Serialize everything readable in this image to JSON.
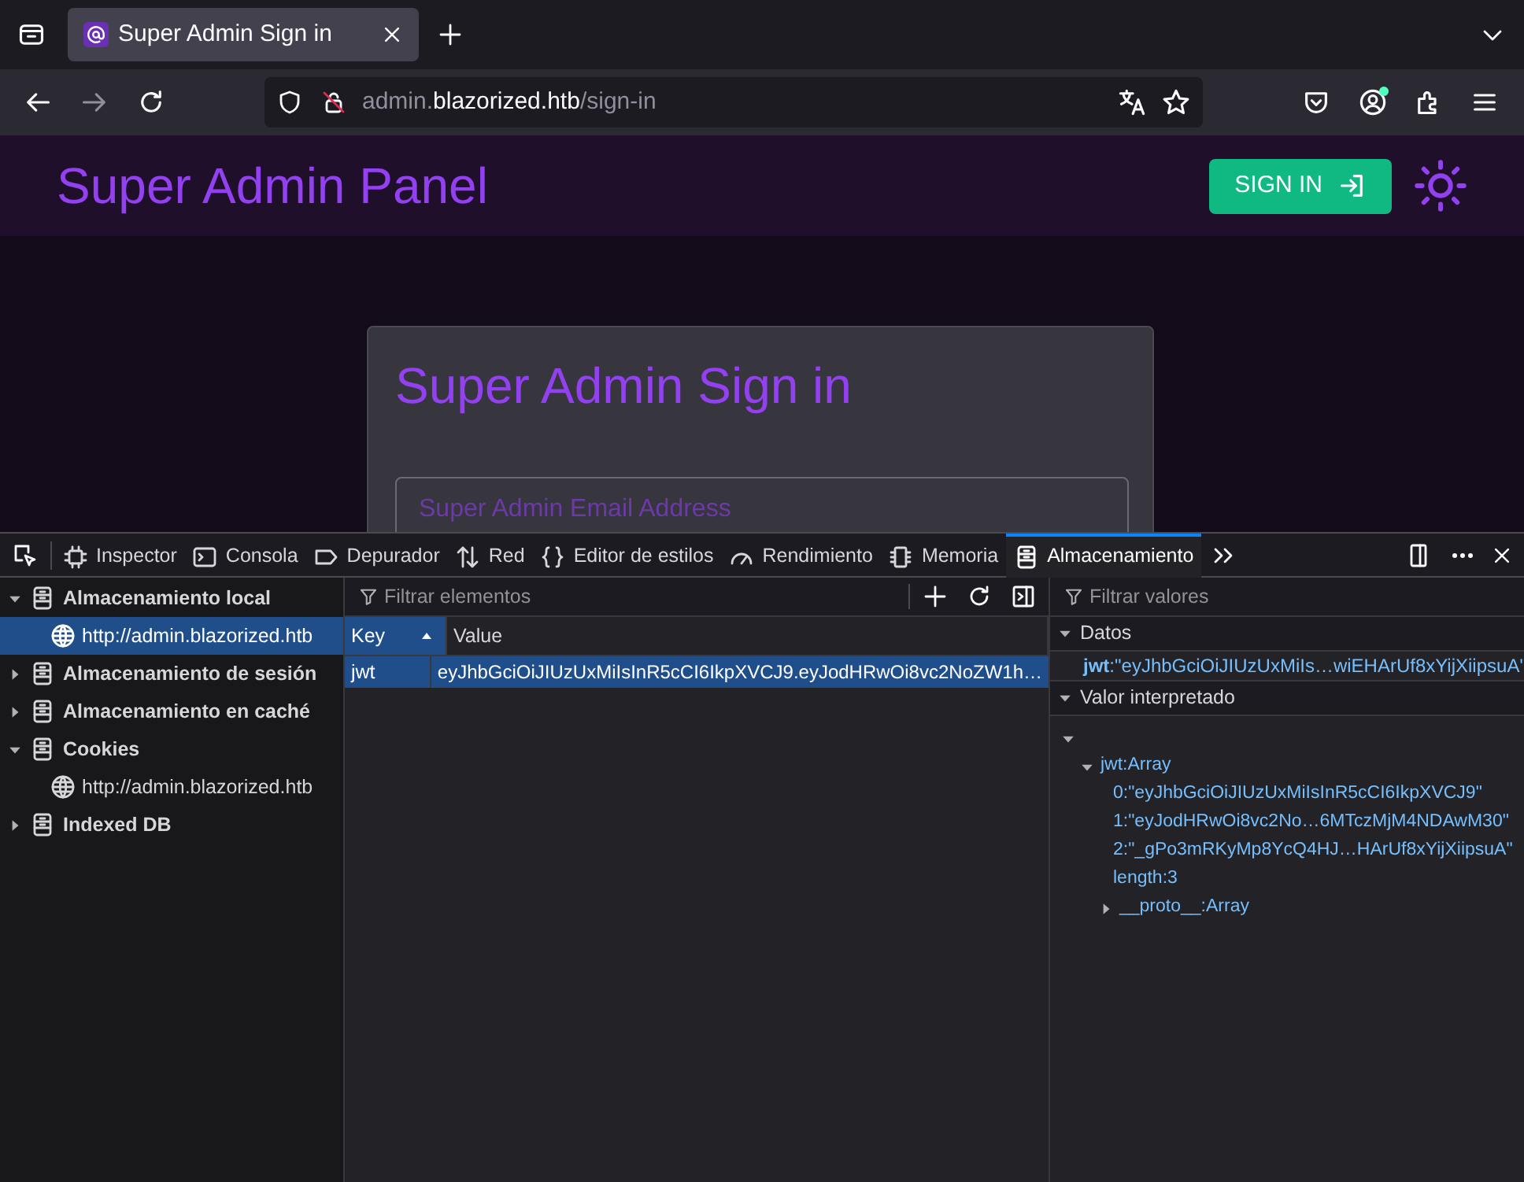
{
  "browser": {
    "tabs": [
      {
        "title": "Super Admin Sign in",
        "selected": true
      }
    ],
    "url": {
      "subdomain": "admin.",
      "domain": "blazorized.htb",
      "path": "/sign-in"
    }
  },
  "page": {
    "title": "Super Admin Panel",
    "sign_in_button": "SIGN IN",
    "card_title": "Super Admin Sign in",
    "email_field": {
      "placeholder": "Super Admin Email Address"
    }
  },
  "devtools": {
    "tools": [
      {
        "label": "Inspector",
        "kind": "inspector",
        "selected": false
      },
      {
        "label": "Consola",
        "kind": "console",
        "selected": false
      },
      {
        "label": "Depurador",
        "kind": "debugger",
        "selected": false
      },
      {
        "label": "Red",
        "kind": "network",
        "selected": false
      },
      {
        "label": "Editor de estilos",
        "kind": "style",
        "selected": false
      },
      {
        "label": "Rendimiento",
        "kind": "performance",
        "selected": false
      },
      {
        "label": "Memoria",
        "kind": "memory",
        "selected": false
      },
      {
        "label": "Almacenamiento",
        "kind": "storage",
        "selected": true
      }
    ],
    "sidebar": [
      {
        "label": "Almacenamiento local",
        "expanded": true,
        "children": [
          {
            "label": "http://admin.blazorized.htb",
            "selected": true
          }
        ]
      },
      {
        "label": "Almacenamiento de sesión",
        "expanded": false
      },
      {
        "label": "Almacenamiento en caché",
        "expanded": false
      },
      {
        "label": "Cookies",
        "expanded": true,
        "children": [
          {
            "label": "http://admin.blazorized.htb",
            "selected": false
          }
        ]
      },
      {
        "label": "Indexed DB",
        "expanded": false
      }
    ],
    "filter_items": {
      "placeholder": "Filtrar elementos"
    },
    "filter_values": {
      "placeholder": "Filtrar valores"
    },
    "table": {
      "columns": [
        {
          "label": "Key",
          "sorted": true
        },
        {
          "label": "Value",
          "sorted": false
        }
      ],
      "rows": [
        {
          "key": "jwt",
          "value": "eyJhbGciOiJIUzUxMiIsInR5cCI6IkpXVCJ9.eyJodHRwOi8vc2NoZW1h…",
          "selected": true
        }
      ]
    },
    "details": {
      "data_section": {
        "title": "Datos",
        "expanded": true,
        "text": "**jwt**:\"eyJhbGciOiJIUzUxMiIs…wiEHArUf8xYijXiipsuA\""
      },
      "parsed_section": {
        "title": "Valor interpretado",
        "expanded": true,
        "tree": [
          {
            "expanded": true,
            "children": [
              {
                "label": "jwt:Array",
                "expanded": true,
                "children": [
                  {
                    "label": "0:\"eyJhbGciOiJIUzUxMiIsInR5cCI6IkpXVCJ9\""
                  },
                  {
                    "label": "1:\"eyJodHRwOi8vc2No…6MTczMjM4NDAwM30\""
                  },
                  {
                    "label": "2:\"_gPo3mRKyMp8YcQ4HJ…HArUf8xYijXiipsuA\""
                  },
                  {
                    "label": "length:3"
                  },
                  {
                    "label": "__proto__:Array",
                    "expanded": false
                  }
                ]
              }
            ]
          }
        ]
      }
    }
  }
}
